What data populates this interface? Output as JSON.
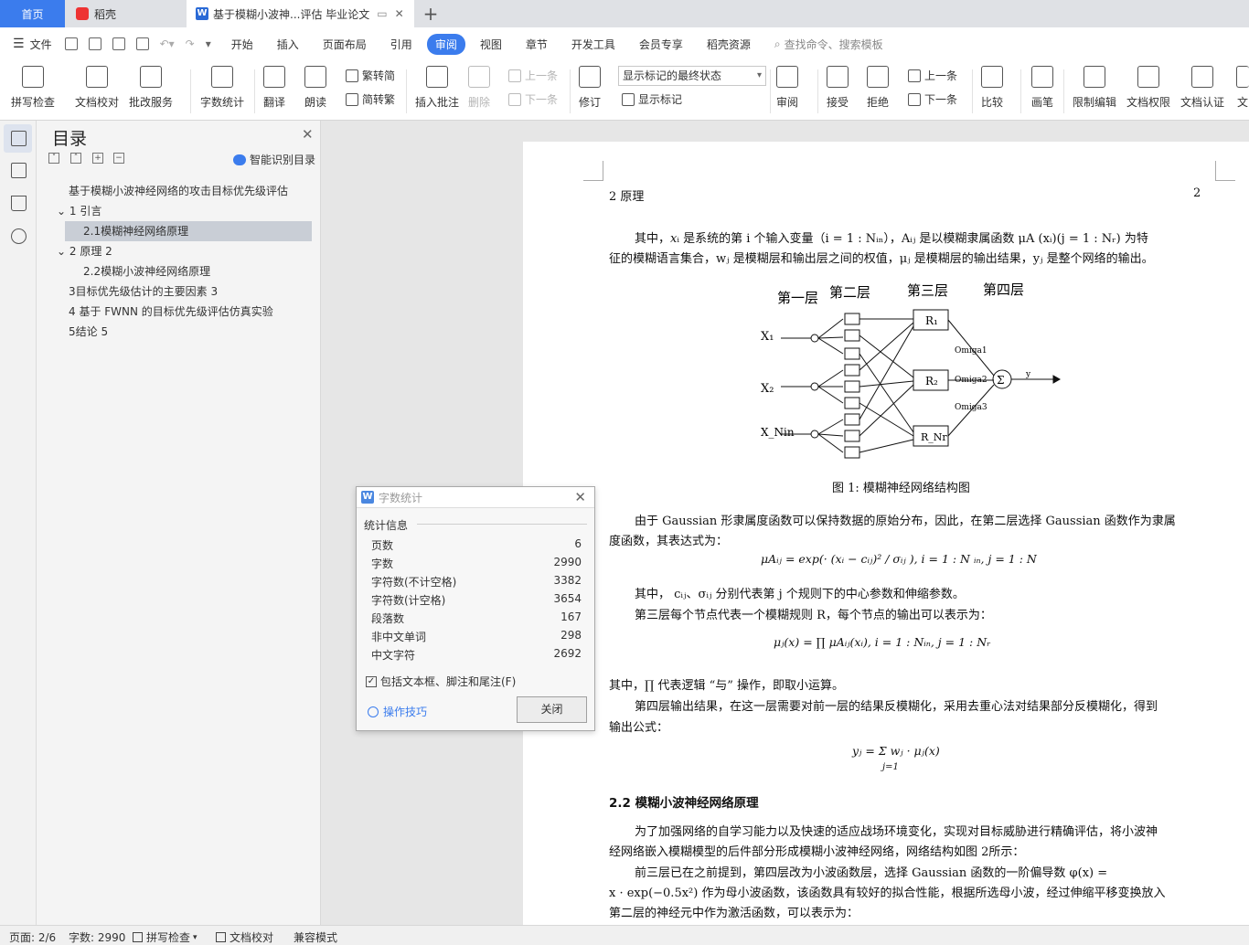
{
  "tabs": {
    "home": "首页",
    "daoke": "稻壳",
    "doc": "基于模糊小波神...评估 毕业论文",
    "plus": "+"
  },
  "menu": {
    "file": "文件",
    "items": [
      "开始",
      "插入",
      "页面布局",
      "引用",
      "审阅",
      "视图",
      "章节",
      "开发工具",
      "会员专享",
      "稻壳资源"
    ],
    "active": "审阅",
    "search": "查找命令、搜索模板"
  },
  "ribbon": {
    "spell": "拼写检查",
    "proof": "文档校对",
    "batch": "批改服务",
    "wordcount": "字数统计",
    "translate": "翻译",
    "read": "朗读",
    "trad": "繁转简",
    "simp": "简转繁",
    "insert_comment": "插入批注",
    "delete": "删除",
    "prev": "上一条",
    "next": "下一条",
    "revise": "修订",
    "show_final": "显示标记的最终状态",
    "show_marks": "显示标记",
    "review": "审阅",
    "accept": "接受",
    "reject": "拒绝",
    "prev2": "上一条",
    "next2": "下一条",
    "compare": "比较",
    "pen": "画笔",
    "restrict": "限制编辑",
    "perm": "文档权限",
    "cert": "文档认证",
    "more": "文"
  },
  "toc": {
    "title": "目录",
    "smart": "智能识别目录",
    "items": [
      "基于模糊小波神经网络的攻击目标优先级评估",
      "1 引言",
      "2.1模糊神经网络原理",
      "2 原理 2",
      "2.2模糊小波神经网络原理",
      "3目标优先级估计的主要因素 3",
      "4 基于 FWNN 的目标优先级评估仿真实验",
      "5结论 5"
    ]
  },
  "doc": {
    "header_left": "2   原理",
    "header_right": "2",
    "p1a": "其中，𝑥ᵢ 是系统的第 i 个输入变量（i = 1 : Nᵢₙ），Aᵢⱼ 是以模糊隶属函数 μA (xᵢ)(j = 1 : Nᵣ) 为特",
    "p1b": "征的模糊语言集合，wⱼ 是模糊层和输出层之间的权值，μⱼ 是模糊层的输出结果，yⱼ 是整个网络的输出。",
    "layer1": "第一层",
    "layer2": "第二层",
    "layer3": "第三层",
    "layer4": "第四层",
    "x1": "X₁",
    "x2": "X₂",
    "xn": "X_Nin",
    "r1": "R₁",
    "r2": "R₂",
    "rn": "R_Nr",
    "omega1": "Omiga1",
    "omega2": "Omiga2",
    "omega3": "Omiga3",
    "sigma": "Σ",
    "y": "y",
    "fig_caption": "图 1: 模糊神经网络结构图",
    "p2a": "由于 Gaussian 形隶属度函数可以保持数据的原始分布，因此，在第二层选择 Gaussian 函数作为隶属",
    "p2b": "度函数，其表达式为：",
    "f1": "μAᵢⱼ = exp(· (xᵢ − cᵢⱼ)² / σᵢⱼ ), i = 1 : N         ᵢₙ, j = 1 : N",
    "p3": "其中， cᵢⱼ、σᵢⱼ 分别代表第 j 个规则下的中心参数和伸缩参数。",
    "p4": "第三层每个节点代表一个模糊规则 R，每个节点的输出可以表示为：",
    "f2": "μⱼ(x) =  ∏ μAᵢⱼ(xᵢ),       i = 1 : Nᵢₙ, j = 1 : Nᵣ",
    "p5": "其中，∏ 代表逻辑 “与” 操作，即取小运算。",
    "p6a": "第四层输出结果，在这一层需要对前一层的结果反模糊化，采用去重心法对结果部分反模糊化，得到",
    "p6b": "输出公式：",
    "f3": "yⱼ =  Σ  wⱼ · μⱼ(x)",
    "f3sub": "j=1",
    "h22": "2.2   模糊小波神经网络原理",
    "p7a": "为了加强网络的自学习能力以及快速的适应战场环境变化，实现对目标威胁进行精确评估，将小波神",
    "p7b": "经网络嵌入模糊模型的后件部分形成模糊小波神经网络，网络结构如图 2所示：",
    "p8a": "前三层已在之前提到，第四层改为小波函数层，选择  Gaussian 函数的一阶偏导数  φ(x) =",
    "p8b": "x · exp(−0.5x²) 作为母小波函数，该函数具有较好的拟合性能，根据所选母小波，经过伸缩平移变换放入",
    "p8c": "第二层的神经元中作为激活函数，可以表示为："
  },
  "dialog": {
    "title": "字数统计",
    "section": "统计信息",
    "rows": [
      {
        "label": "页数",
        "value": "6"
      },
      {
        "label": "字数",
        "value": "2990"
      },
      {
        "label": "字符数(不计空格)",
        "value": "3382"
      },
      {
        "label": "字符数(计空格)",
        "value": "3654"
      },
      {
        "label": "段落数",
        "value": "167"
      },
      {
        "label": "非中文单词",
        "value": "298"
      },
      {
        "label": "中文字符",
        "value": "2692"
      }
    ],
    "checkbox": "包括文本框、脚注和尾注(F)",
    "tips": "操作技巧",
    "close": "关闭"
  },
  "status": {
    "page": "页面: 2/6",
    "words": "字数: 2990",
    "spell": "拼写检查",
    "proof": "文档校对",
    "compat": "兼容模式"
  }
}
